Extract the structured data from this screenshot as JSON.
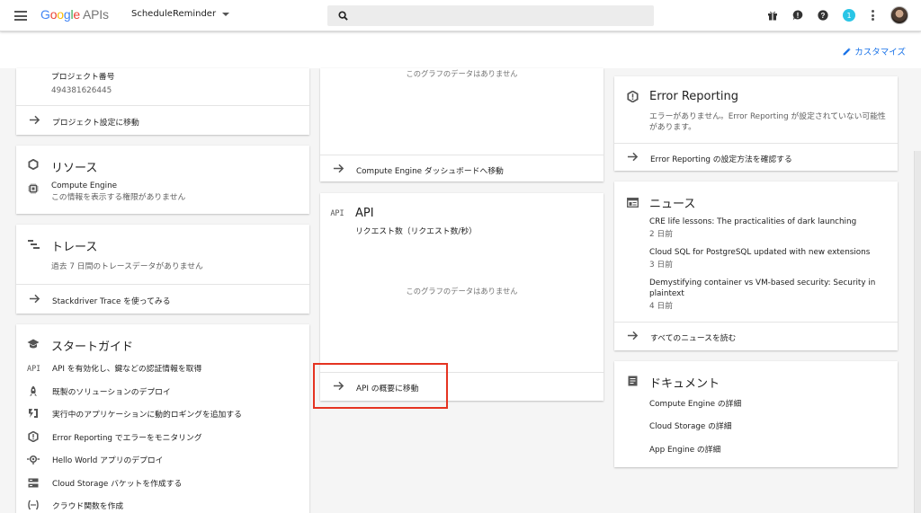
{
  "header": {
    "logo": {
      "G": "G",
      "o1": "o",
      "o2": "o",
      "g": "g",
      "l": "l",
      "e": "e",
      "apis": "APIs"
    },
    "project": "ScheduleReminder",
    "notification_count": "1",
    "icons": [
      "menu-icon",
      "search-icon",
      "gift-icon",
      "feedback-icon",
      "help-icon",
      "more-vert-icon",
      "avatar"
    ]
  },
  "subbar": {
    "customize": "カスタマイズ"
  },
  "col1": {
    "project_card": {
      "label": "プロジェクト番号",
      "number": "494381626445",
      "link": "プロジェクト設定に移動"
    },
    "resources": {
      "title": "リソース",
      "item": "Compute Engine",
      "item_note": "この情報を表示する権限がありません"
    },
    "trace": {
      "title": "トレース",
      "note": "過去 7 日間のトレースデータがありません",
      "link": "Stackdriver Trace を使ってみる"
    },
    "guide": {
      "title": "スタートガイド",
      "items": [
        {
          "label": "API を有効化し、鍵などの認証情報を取得",
          "icon": "api-icon"
        },
        {
          "label": "既製のソリューションのデプロイ",
          "icon": "rocket-icon"
        },
        {
          "label": "実行中のアプリケーションに動的ロギングを追加する",
          "icon": "debug-icon"
        },
        {
          "label": "Error Reporting でエラーをモニタリング",
          "icon": "error-reporting-icon"
        },
        {
          "label": "Hello World アプリのデプロイ",
          "icon": "app-engine-icon"
        },
        {
          "label": "Cloud Storage バケットを作成する",
          "icon": "storage-icon"
        },
        {
          "label": "クラウド関数を作成",
          "icon": "functions-icon"
        }
      ]
    }
  },
  "col2": {
    "compute": {
      "nodata": "このグラフのデータはありません",
      "link": "Compute Engine ダッシュボードへ移動"
    },
    "api": {
      "icon_text": "API",
      "title": "API",
      "subtitle": "リクエスト数（リクエスト数/秒）",
      "nodata": "このグラフのデータはありません",
      "link": "API の概要に移動"
    }
  },
  "col3": {
    "error_reporting": {
      "title": "Error Reporting",
      "text": "エラーがありません。Error Reporting が設定されていない可能性があります。",
      "link": "Error Reporting の設定方法を確認する"
    },
    "news": {
      "title": "ニュース",
      "items": [
        {
          "title": "CRE life lessons: The practicalities of dark launching",
          "age": "2 日前"
        },
        {
          "title": "Cloud SQL for PostgreSQL updated with new extensions",
          "age": "3 日前"
        },
        {
          "title": "Demystifying container vs VM-based security: Security in plaintext",
          "age": "4 日前"
        }
      ],
      "link": "すべてのニュースを読む"
    },
    "docs": {
      "title": "ドキュメント",
      "items": [
        "Compute Engine の詳細",
        "Cloud Storage の詳細",
        "App Engine の詳細"
      ]
    }
  },
  "colors": {
    "accent": "#1a73e8",
    "highlight": "#e53321",
    "notification": "#29c5e6"
  }
}
